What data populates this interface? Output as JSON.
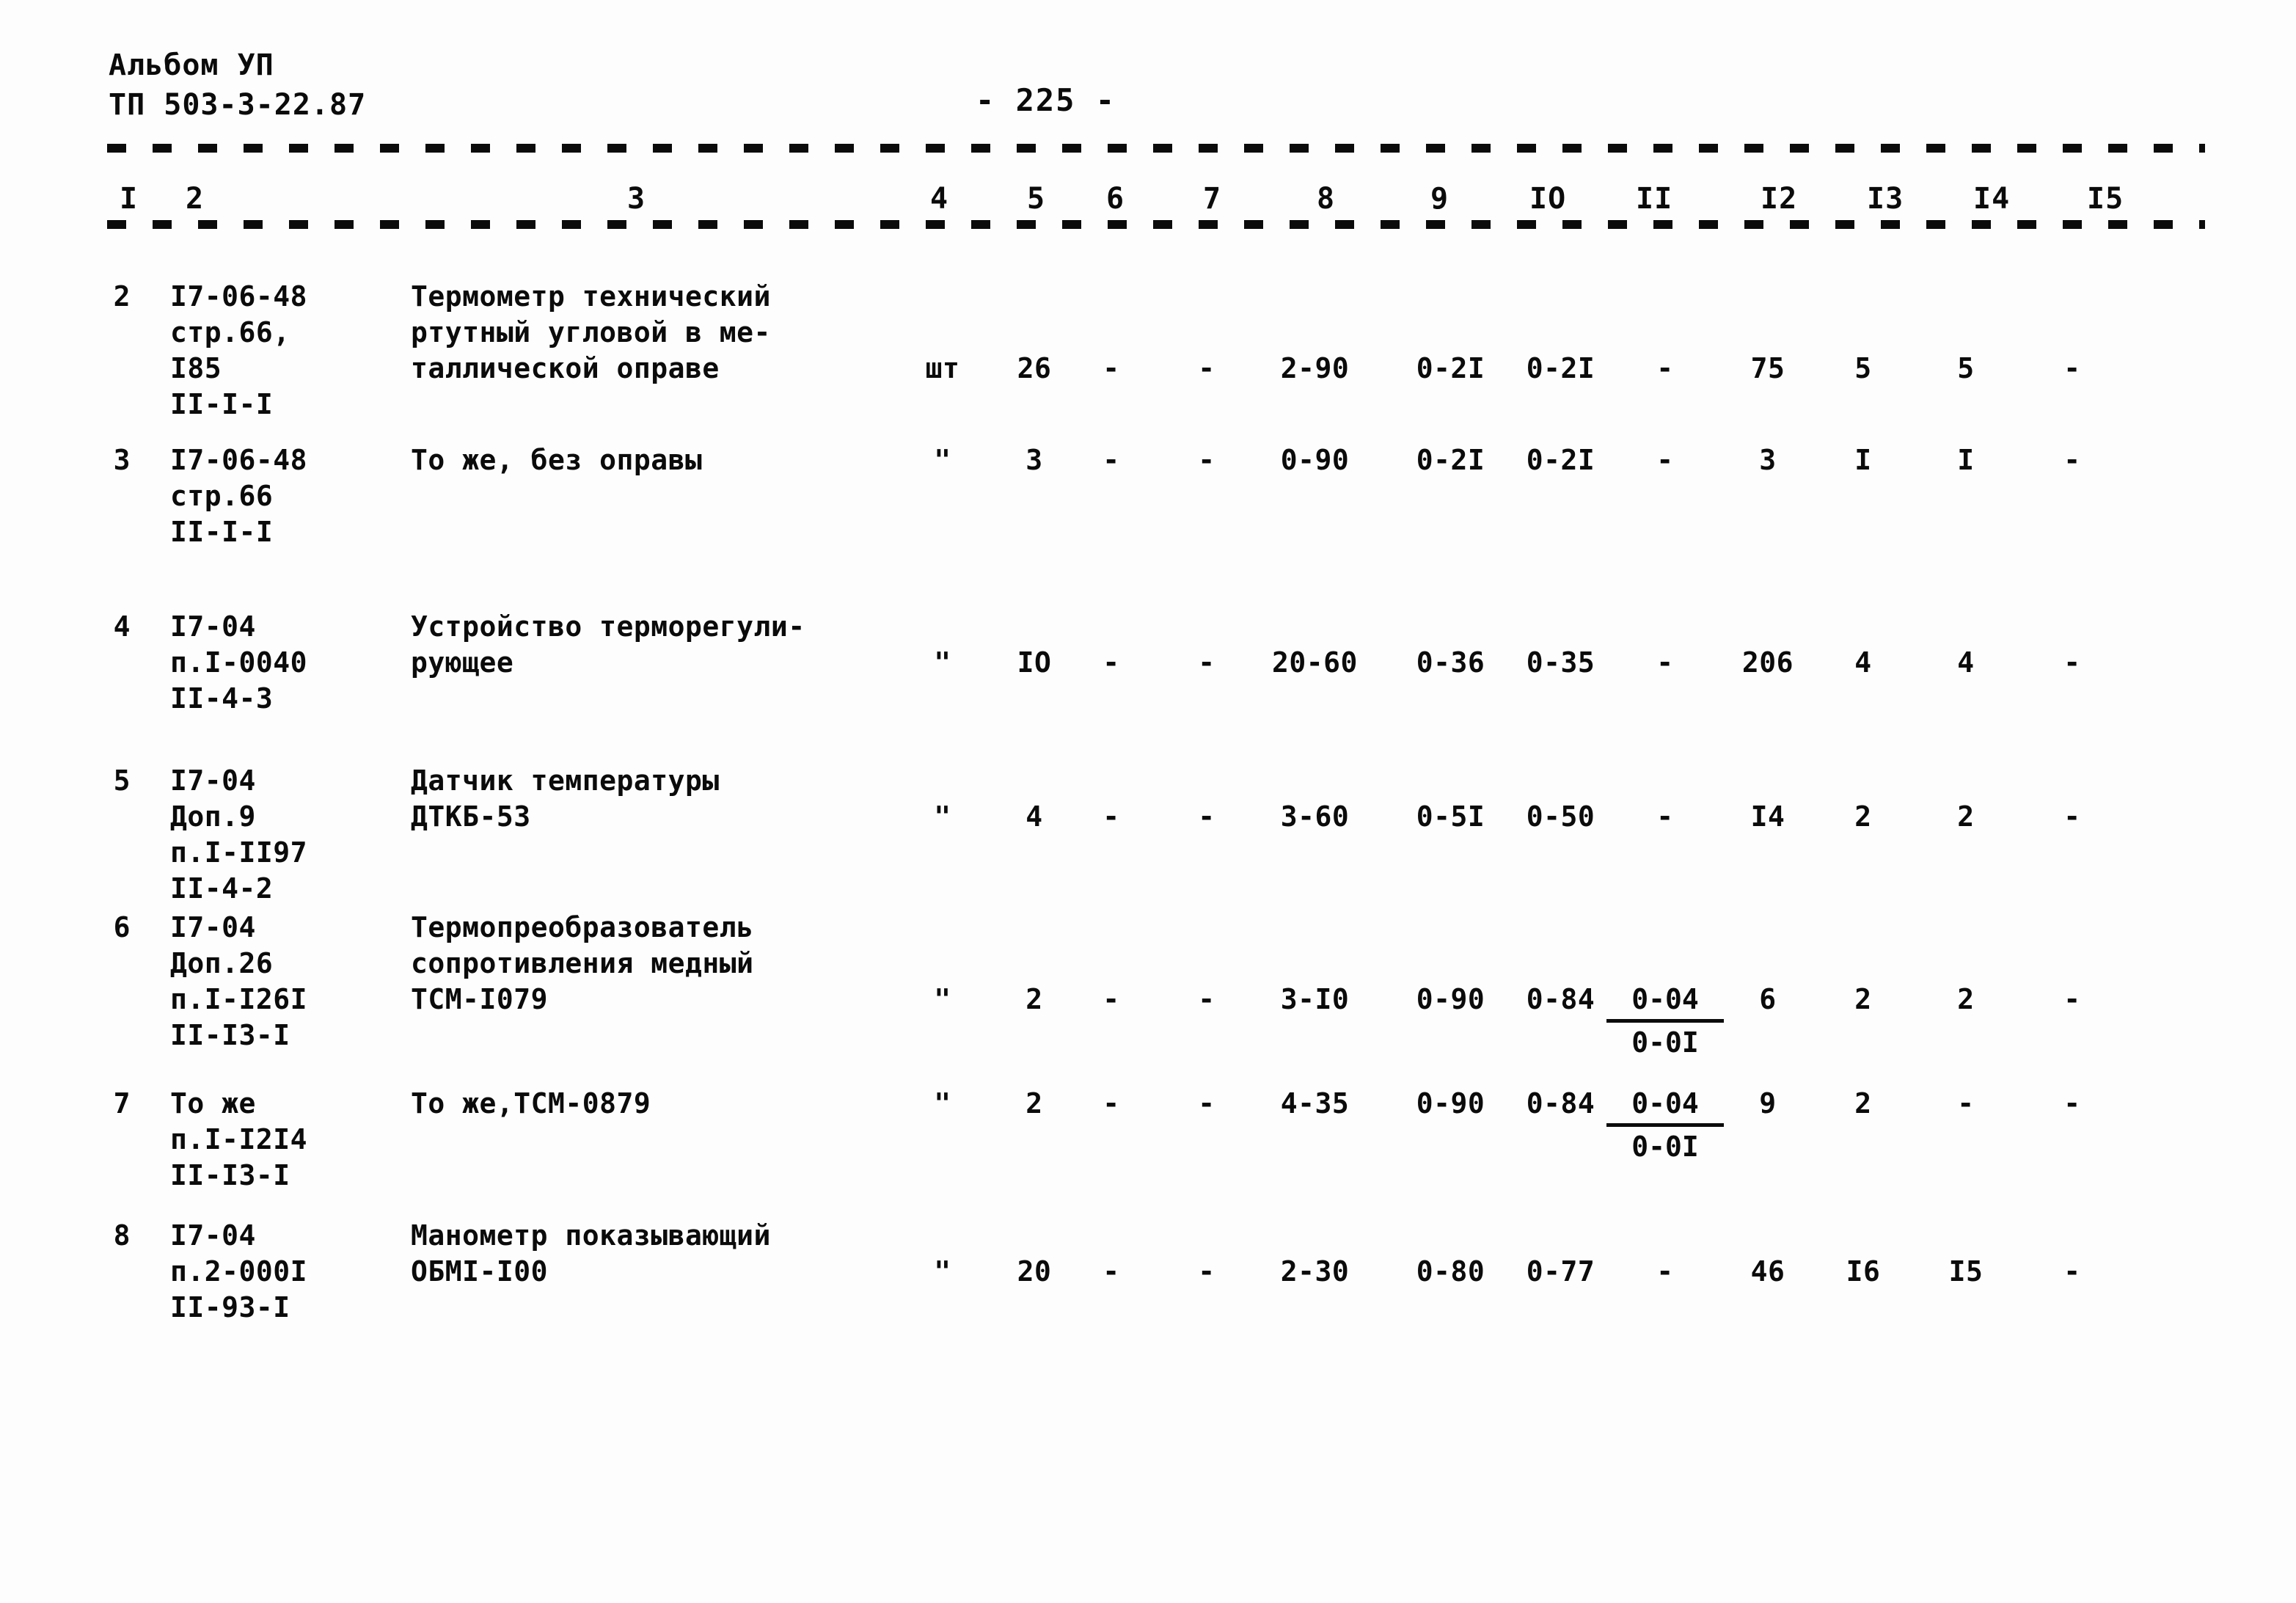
{
  "header": {
    "album": "Альбом УП",
    "code": "ТП 503-3-22.87",
    "page_number": "- 225 -"
  },
  "table": {
    "column_headers": [
      "I",
      "2",
      "3",
      "4",
      "5",
      "6",
      "7",
      "8",
      "9",
      "IO",
      "II",
      "I2",
      "I3",
      "I4",
      "I5"
    ],
    "rows": [
      {
        "idx": "2",
        "code": "I7-06-48\nстр.66,\nI85\nII-I-I",
        "name": "Термометр технический\nртутный угловой в ме-\nталлической оправе",
        "unit": "шт",
        "c5": "26",
        "c6": "-",
        "c7": "-",
        "c8": "2-90",
        "c9": "0-2I",
        "c10": "0-2I",
        "c11": "-",
        "c12": "75",
        "c13": "5",
        "c14": "5",
        "c15": "-"
      },
      {
        "idx": "3",
        "code": "I7-06-48\nстр.66\nII-I-I",
        "name": "То же, без оправы",
        "unit": "\"",
        "c5": "3",
        "c6": "-",
        "c7": "-",
        "c8": "0-90",
        "c9": "0-2I",
        "c10": "0-2I",
        "c11": "-",
        "c12": "3",
        "c13": "I",
        "c14": "I",
        "c15": "-"
      },
      {
        "idx": "4",
        "code": "I7-04\nп.I-0040\nII-4-3",
        "name": "Устройство терморегули-\nрующее",
        "unit": "\"",
        "c5": "IO",
        "c6": "-",
        "c7": "-",
        "c8": "20-60",
        "c9": "0-36",
        "c10": "0-35",
        "c11": "-",
        "c12": "206",
        "c13": "4",
        "c14": "4",
        "c15": "-"
      },
      {
        "idx": "5",
        "code": "I7-04\nДоп.9\nп.I-II97\nII-4-2",
        "name": "Датчик температуры\nДТКБ-53",
        "unit": "\"",
        "c5": "4",
        "c6": "-",
        "c7": "-",
        "c8": "3-60",
        "c9": "0-5I",
        "c10": "0-50",
        "c11": "-",
        "c12": "I4",
        "c13": "2",
        "c14": "2",
        "c15": "-"
      },
      {
        "idx": "6",
        "code": "I7-04\nДоп.26\nп.I-I26I\nII-I3-I",
        "name": "Термопреобразователь\nсопротивления медный\nТСМ-I079",
        "unit": "\"",
        "c5": "2",
        "c6": "-",
        "c7": "-",
        "c8": "3-I0",
        "c9": "0-90",
        "c10": "0-84",
        "c11_top": "0-04",
        "c11_bottom": "0-0I",
        "c12": "6",
        "c13": "2",
        "c14": "2",
        "c15": "-"
      },
      {
        "idx": "7",
        "code": "То же\nп.I-I2I4\nII-I3-I",
        "name": "То же,ТСМ-0879",
        "unit": "\"",
        "c5": "2",
        "c6": "-",
        "c7": "-",
        "c8": "4-35",
        "c9": "0-90",
        "c10": "0-84",
        "c11_top": "0-04",
        "c11_bottom": "0-0I",
        "c12": "9",
        "c13": "2",
        "c14": "-",
        "c15": "-"
      },
      {
        "idx": "8",
        "code": "I7-04\nп.2-000I\nII-93-I",
        "name": "Манометр показывающий\nОБМI-I00",
        "unit": "\"",
        "c5": "20",
        "c6": "-",
        "c7": "-",
        "c8": "2-30",
        "c9": "0-80",
        "c10": "0-77",
        "c11": "-",
        "c12": "46",
        "c13": "I6",
        "c14": "I5",
        "c15": "-"
      }
    ]
  }
}
